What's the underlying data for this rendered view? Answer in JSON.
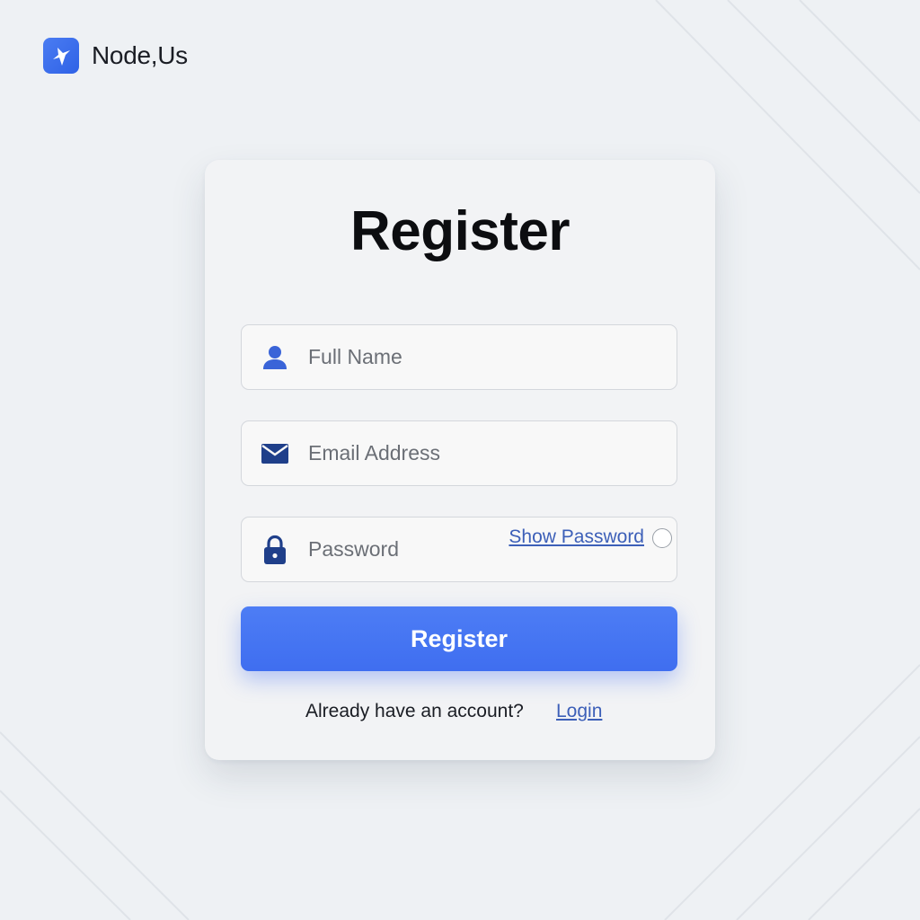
{
  "brand": {
    "name": "Node,Us",
    "icon": "brand-logo-icon",
    "color": "#3a6cec"
  },
  "form": {
    "title": "Register",
    "fields": {
      "full_name": {
        "placeholder": "Full Name",
        "icon": "user-icon"
      },
      "email": {
        "placeholder": "Email Address",
        "icon": "envelope-icon"
      },
      "password": {
        "placeholder": "Password",
        "icon": "lock-icon",
        "show_password_label": "Show Password"
      }
    },
    "submit_label": "Register",
    "footer_prompt": "Already have an account?",
    "login_link": "Login"
  },
  "colors": {
    "accent": "#4a79f3",
    "icon": "#3a64d8",
    "link": "#3c5fb8",
    "background": "#eef1f4"
  }
}
